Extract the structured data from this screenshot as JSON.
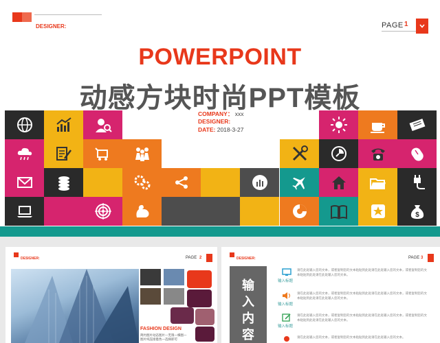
{
  "header": {
    "designer_label": "DESIGNER:",
    "page_label": "PAGE",
    "page_number": "1"
  },
  "title": {
    "english": "POWERPOINT",
    "chinese": "动感方块时尚PPT模板"
  },
  "meta": {
    "company_label": "COMPANY：",
    "company_value": "xxx",
    "designer_label": "DESIGNER:",
    "designer_value": "",
    "date_label": "DATE:",
    "date_value": "2018-3-27"
  },
  "colors": {
    "accent": "#e8381b",
    "teal": "#14998e",
    "magenta": "#d6246e",
    "yellow": "#f2b315",
    "orange": "#ee7a1f",
    "gray": "#4d4d4d",
    "dark": "#2a2a2a"
  },
  "tiles": [
    {
      "icon": "globe-icon"
    },
    {
      "icon": "chart-growth-icon"
    },
    {
      "icon": "user-search-icon"
    },
    {
      "icon": "sun-icon"
    },
    {
      "icon": "coffee-cup-icon"
    },
    {
      "icon": "ticket-icon"
    },
    {
      "icon": "cloud-rain-icon"
    },
    {
      "icon": "document-edit-icon"
    },
    {
      "icon": "cart-icon"
    },
    {
      "icon": "team-icon"
    },
    {
      "icon": "tools-icon"
    },
    {
      "icon": "timer-icon"
    },
    {
      "icon": "telephone-icon"
    },
    {
      "icon": "mouse-icon"
    },
    {
      "icon": "mail-icon"
    },
    {
      "icon": "coins-icon"
    },
    {
      "icon": "gears-icon"
    },
    {
      "icon": "share-icon"
    },
    {
      "icon": "bar-chart-icon"
    },
    {
      "icon": "airplane-icon"
    },
    {
      "icon": "home-icon"
    },
    {
      "icon": "folder-icon"
    },
    {
      "icon": "plug-icon"
    },
    {
      "icon": "laptop-icon"
    },
    {
      "icon": "target-icon"
    },
    {
      "icon": "muscle-icon"
    },
    {
      "icon": "pie-chart-icon"
    },
    {
      "icon": "book-icon"
    },
    {
      "icon": "star-icon"
    },
    {
      "icon": "money-bag-icon"
    }
  ],
  "thumb_left": {
    "designer_label": "DESIGNER:",
    "page_label": "PAGE",
    "page_number": "2",
    "caption_title": "FASHION DESIGN",
    "caption_lines": [
      "简约图片动态图片—无限一横图一",
      "图片纯压接着色一选择即可"
    ]
  },
  "thumb_right": {
    "designer_label": "DESIGNER:",
    "page_label": "PAGE",
    "page_number": "3",
    "side_label": [
      "输",
      "入",
      "内",
      "容"
    ],
    "items": [
      {
        "icon": "monitor-icon",
        "label": "输入标题"
      },
      {
        "icon": "speaker-icon",
        "label": "输入标题"
      },
      {
        "icon": "edit-icon",
        "label": "输入标题"
      },
      {
        "icon": "pin-icon",
        "label": ""
      }
    ],
    "paragraphs": [
      "请在此处输入您的文本，或者复制您的文本粘贴到此处请在此处输入您的文本，或者复制您的文本粘贴到此处请在此处输入您的文本。",
      "请在此处输入您的文本，或者复制您的文本粘贴到此处请在此处输入您的文本，或者复制您的文本粘贴到此处请在此处输入您的文本。",
      "请在此处输入您的文本，或者复制您的文本粘贴到此处请在此处输入您的文本，或者复制您的文本粘贴到此处请在此处输入您的文本。",
      "请在此处输入您的文本，或者复制您的文本粘贴到此处请在此处输入您的文本。"
    ]
  }
}
